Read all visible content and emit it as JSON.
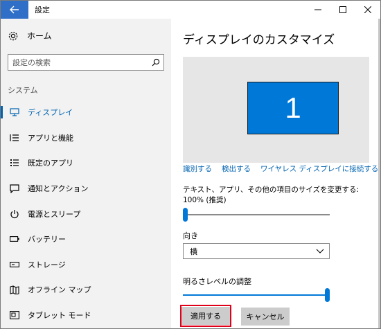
{
  "window": {
    "title": "設定",
    "back_icon": "arrow-left-icon",
    "controls": [
      "minimize-icon",
      "maximize-icon",
      "close-icon"
    ]
  },
  "sidebar": {
    "home": {
      "label": "ホーム",
      "icon": "gear-icon"
    },
    "search": {
      "placeholder": "設定の検索",
      "icon": "search-icon"
    },
    "section_label": "システム",
    "items": [
      {
        "label": "ディスプレイ",
        "icon": "monitor-icon",
        "active": true
      },
      {
        "label": "アプリと機能",
        "icon": "app-list-icon"
      },
      {
        "label": "既定のアプリ",
        "icon": "default-apps-icon"
      },
      {
        "label": "通知とアクション",
        "icon": "notification-icon"
      },
      {
        "label": "電源とスリープ",
        "icon": "power-icon"
      },
      {
        "label": "バッテリー",
        "icon": "battery-icon"
      },
      {
        "label": "ストレージ",
        "icon": "storage-icon"
      },
      {
        "label": "オフライン マップ",
        "icon": "map-icon"
      },
      {
        "label": "タブレット モード",
        "icon": "tablet-icon"
      }
    ]
  },
  "main": {
    "title": "ディスプレイのカスタマイズ",
    "monitor_number": "1",
    "links": {
      "identify": "識別する",
      "detect": "検出する",
      "wireless": "ワイヤレス ディスプレイに接続する"
    },
    "scale_label": "テキスト、アプリ、その他の項目のサイズを変更する: 100% (推奨)",
    "scale_slider_value": 0,
    "orientation_label": "向き",
    "orientation_value": "横",
    "brightness_label": "明るさレベルの調整",
    "brightness_value": 1.0,
    "apply_label": "適用する",
    "cancel_label": "キャンセル"
  },
  "colors": {
    "accent": "#0078d7",
    "link": "#0063b1",
    "highlight_border": "#e0001a",
    "sidebar_bg": "#f2f2f2"
  }
}
